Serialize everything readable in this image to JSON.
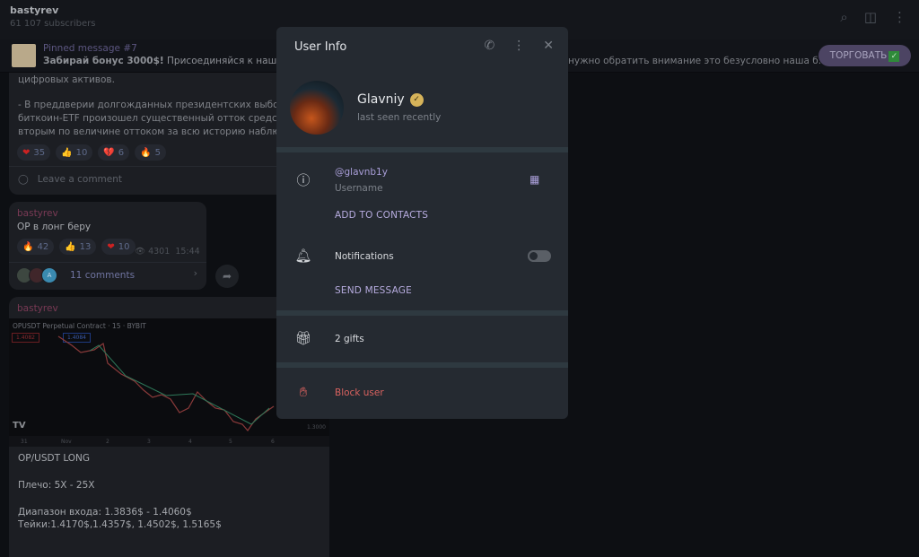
{
  "header": {
    "title": "bastyrev",
    "subtitle": "61 107 subscribers",
    "icons": [
      "search-icon",
      "sidebar-toggle-icon",
      "more-vertical-icon"
    ]
  },
  "pinned": {
    "title": "Pinned message #7",
    "text_bold": "Забирай бонус 3000$!",
    "text": " Присоединяйся к нашей ко",
    "text_tail": "нужно обратить внимание это безусловно наша б...",
    "button_label": "ТОРГОВАТЬ",
    "button_emoji": "✓"
  },
  "messages": [
    {
      "lines": [
        "цифровых активов.",
        "",
        "- В преддверии долгожданных президентских выборов",
        "биткоин-ETF произошел существенный отток средств, ч",
        "вторым по величине оттоком за всю историю наблюде"
      ],
      "reactions": [
        {
          "emoji": "❤",
          "count": "35"
        },
        {
          "emoji": "👍",
          "count": "10"
        },
        {
          "emoji": "💔",
          "count": "6"
        },
        {
          "emoji": "🔥",
          "count": "5"
        }
      ],
      "comment_label": "Leave a comment"
    },
    {
      "author": "bastyrev",
      "text": "OP в лонг беру",
      "reactions": [
        {
          "emoji": "🔥",
          "count": "42"
        },
        {
          "emoji": "👍",
          "count": "13"
        },
        {
          "emoji": "❤",
          "count": "10"
        }
      ],
      "views": "4301",
      "time": "15:44",
      "comments_label": "11 comments",
      "avatar_letter": "A"
    },
    {
      "author": "bastyrev",
      "chart_title": "OPUSDT Perpetual Contract · 15 · BYBIT",
      "sell": "1.4082",
      "buy": "1.4084",
      "price_label": "1.3000",
      "x_ticks": [
        "31",
        "Nov",
        "2",
        "3",
        "4",
        "5",
        "6"
      ],
      "lines": [
        "OP/USDT LONG",
        "",
        "Плечо: 5X - 25X",
        "",
        "Диапазон входа: 1.3836$ - 1.4060$",
        "Тейки:1.4170$,1.4357$, 1.4502$, 1.5165$"
      ]
    }
  ],
  "user_info": {
    "title": "User Info",
    "name": "Glavniy",
    "status": "last seen recently",
    "username": "@glavnb1y",
    "username_label": "Username",
    "add_contacts": "ADD TO CONTACTS",
    "notifications": "Notifications",
    "notifications_on": false,
    "send_message": "SEND MESSAGE",
    "gifts": "2 gifts",
    "block": "Block user"
  },
  "colors": {
    "accent": "#b7acdf",
    "danger": "#d9625f",
    "verified": "#d6b35a",
    "modal_bg": "#252a31"
  }
}
